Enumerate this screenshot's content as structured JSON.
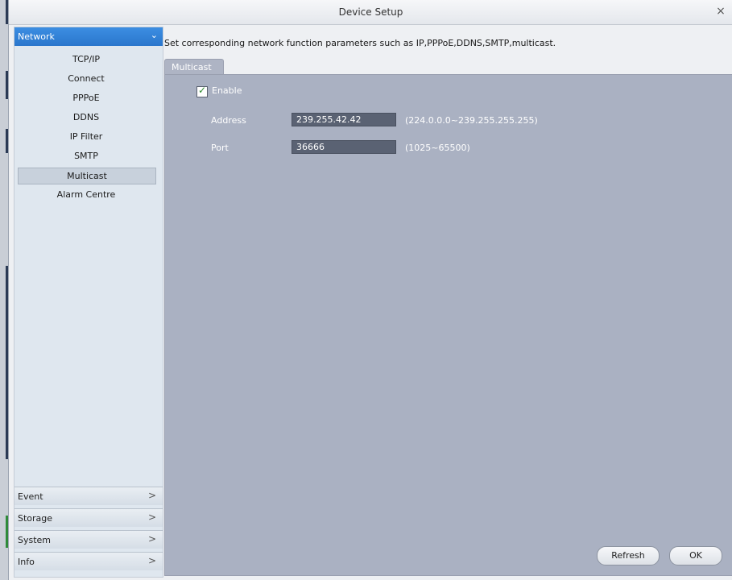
{
  "window": {
    "title": "Device Setup",
    "close_glyph": "×"
  },
  "sidebar": {
    "network": {
      "label": "Network",
      "chevron": "⌄",
      "items": [
        {
          "label": "TCP/IP",
          "active": false
        },
        {
          "label": "Connect",
          "active": false
        },
        {
          "label": "PPPoE",
          "active": false
        },
        {
          "label": "DDNS",
          "active": false
        },
        {
          "label": "IP Filter",
          "active": false
        },
        {
          "label": "SMTP",
          "active": false
        },
        {
          "label": "Multicast",
          "active": true
        },
        {
          "label": "Alarm Centre",
          "active": false
        }
      ]
    },
    "sections": [
      {
        "label": "Event",
        "chevron": ">"
      },
      {
        "label": "Storage",
        "chevron": ">"
      },
      {
        "label": "System",
        "chevron": ">"
      },
      {
        "label": "Info",
        "chevron": ">"
      }
    ]
  },
  "main": {
    "description": "Set corresponding network function parameters such as IP,PPPoE,DDNS,SMTP,multicast.",
    "tab_label": "Multicast",
    "enable": {
      "label": "Enable",
      "checked": true
    },
    "address": {
      "label": "Address",
      "value": "239.255.42.42",
      "hint": "(224.0.0.0~239.255.255.255)"
    },
    "port": {
      "label": "Port",
      "value": "36666",
      "hint": "(1025~65500)"
    },
    "buttons": {
      "refresh": "Refresh",
      "ok": "OK"
    }
  },
  "colors": {
    "sidebar_header": "#2a76cc",
    "panel_bg": "#aab1c2",
    "input_bg": "#5a6273"
  }
}
